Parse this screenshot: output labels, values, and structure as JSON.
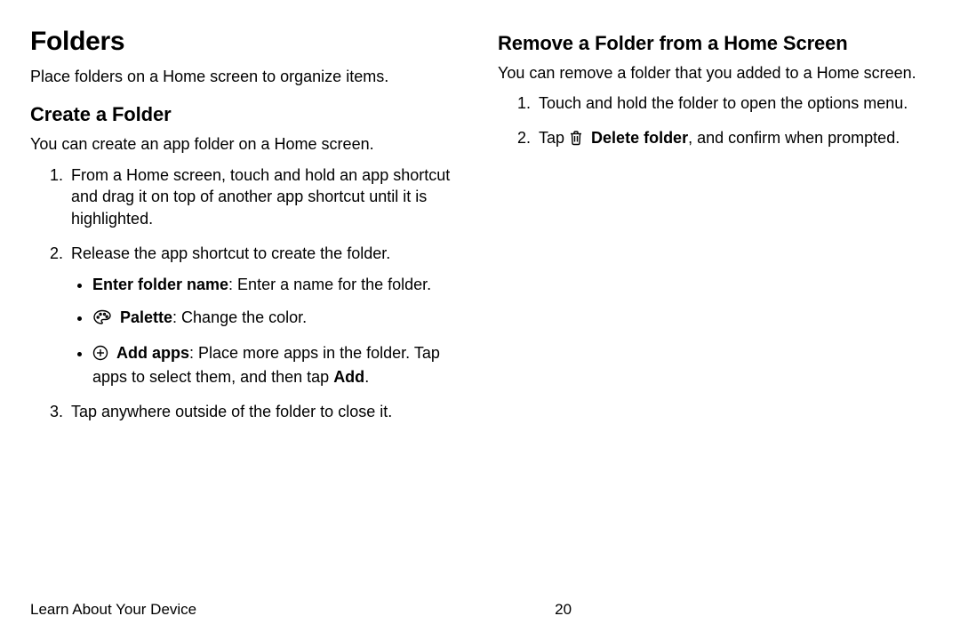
{
  "left": {
    "title": "Folders",
    "intro": "Place folders on a Home screen to organize items.",
    "create": {
      "heading": "Create a Folder",
      "intro": "You can create an app folder on a Home screen.",
      "step1": "From a Home screen, touch and hold an app shortcut and drag it on top of another app shortcut until it is highlighted.",
      "step2": "Release the app shortcut to create the folder.",
      "bullet_enter_name_label": "Enter folder name",
      "bullet_enter_name_rest": ": Enter a name for the folder.",
      "bullet_palette_label": "Palette",
      "bullet_palette_rest": ": Change the color.",
      "bullet_addapps_label": "Add apps",
      "bullet_addapps_mid": ": Place more apps in the folder. Tap apps to select them, and then tap ",
      "bullet_addapps_add": "Add",
      "bullet_addapps_tail": ".",
      "step3": "Tap anywhere outside of the folder to close it."
    }
  },
  "right": {
    "heading": "Remove a Folder from a Home Screen",
    "intro": "You can remove a folder that you added to a Home screen.",
    "step1": "Touch and hold the folder to open the options menu.",
    "step2_pre": "Tap ",
    "step2_label": "Delete folder",
    "step2_rest": ", and confirm when prompted."
  },
  "footer": {
    "section": "Learn About Your Device",
    "page": "20"
  }
}
